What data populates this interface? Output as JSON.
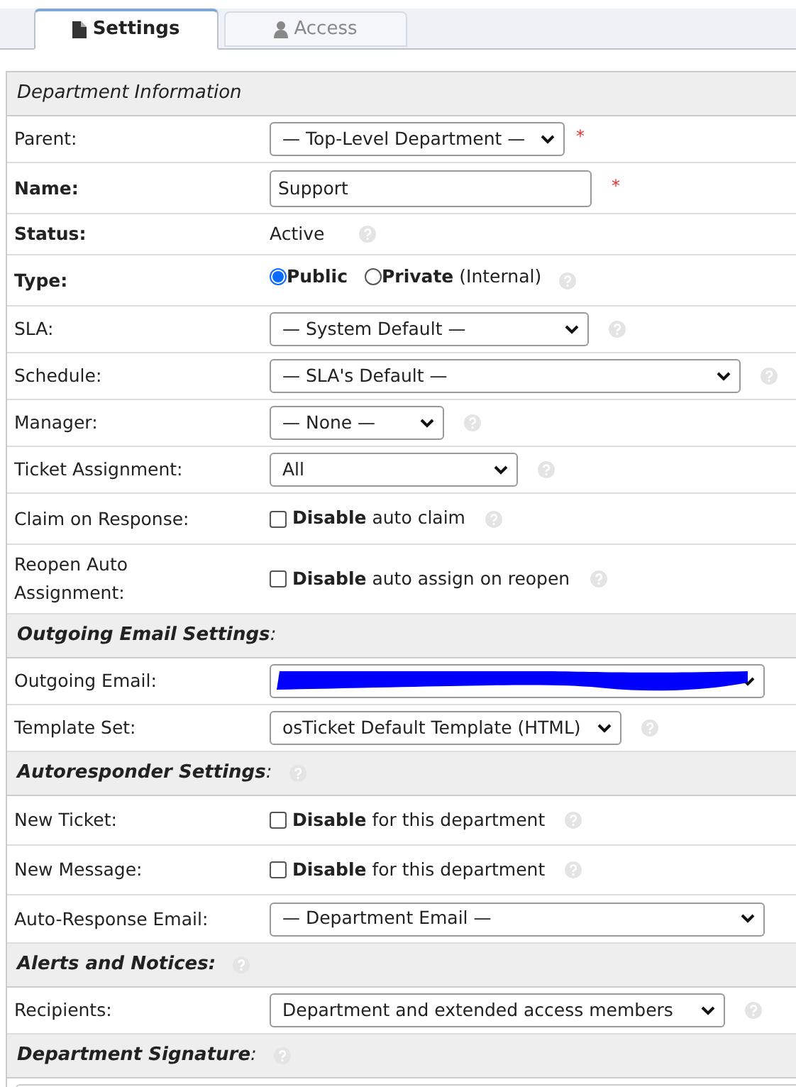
{
  "tabs": [
    {
      "label": "Settings",
      "selected": true
    },
    {
      "label": "Access",
      "selected": false
    }
  ],
  "rows": [
    {
      "kind": "section",
      "title": "Department Information",
      "bold": false,
      "help": false
    },
    {
      "kind": "select",
      "label": "Parent:",
      "label_bold": false,
      "value": "— Top-Level Department —",
      "required": "*",
      "help": false
    },
    {
      "kind": "input",
      "label": "Name:",
      "label_bold": true,
      "value": "Support",
      "required": "*",
      "help": false
    },
    {
      "kind": "text",
      "label": "Status:",
      "label_bold": true,
      "value": "Active",
      "help": true
    },
    {
      "kind": "radio",
      "label": "Type:",
      "label_bold": true,
      "options": [
        {
          "label": "Public",
          "selected": true
        },
        {
          "label": "Private",
          "note": "(Internal)",
          "selected": false
        }
      ],
      "help": true
    },
    {
      "kind": "select",
      "label": "SLA:",
      "label_bold": false,
      "value": "— System Default —",
      "help": true
    },
    {
      "kind": "select",
      "label": "Schedule:",
      "label_bold": false,
      "value": "— SLA's Default —",
      "help": true
    },
    {
      "kind": "select",
      "label": "Manager:",
      "label_bold": false,
      "value": "— None —",
      "help": true
    },
    {
      "kind": "select",
      "label": "Ticket Assignment:",
      "label_bold": false,
      "value": "All",
      "help": true
    },
    {
      "kind": "checkbox",
      "label": "Claim on Response:",
      "label_bold": false,
      "text": "**Disable** auto claim",
      "checked": false,
      "help": true
    },
    {
      "kind": "checkbox",
      "label": "Reopen Auto Assignment:",
      "label_bold": false,
      "text": "**Disable** auto assign on reopen",
      "checked": false,
      "help": true
    },
    {
      "kind": "section",
      "title": "**Outgoing Email Settings**:",
      "bold": false,
      "help": false
    },
    {
      "kind": "select",
      "label": "Outgoing Email:",
      "label_bold": false,
      "redacted": true,
      "help": false
    },
    {
      "kind": "select",
      "label": "Template Set:",
      "label_bold": false,
      "value": "osTicket Default Template (HTML)",
      "help": true
    },
    {
      "kind": "section",
      "title": "**Autoresponder Settings**:",
      "bold": false,
      "help": true
    },
    {
      "kind": "checkbox",
      "label": "New Ticket:",
      "label_bold": false,
      "text": "**Disable** for this department",
      "checked": false,
      "help": true
    },
    {
      "kind": "checkbox",
      "label": "New Message:",
      "label_bold": false,
      "text": "**Disable** for this department",
      "checked": false,
      "help": true
    },
    {
      "kind": "select",
      "label": "Auto-Response Email:",
      "label_bold": false,
      "value": "— Department Email —",
      "help": false
    },
    {
      "kind": "section",
      "title": "Alerts and Notices:",
      "bold": true,
      "help": true
    },
    {
      "kind": "select",
      "label": "Recipients:",
      "label_bold": false,
      "value": "Department and extended access members",
      "help": true
    },
    {
      "kind": "section",
      "title": "**Department Signature**:",
      "bold": false,
      "help": true
    }
  ]
}
